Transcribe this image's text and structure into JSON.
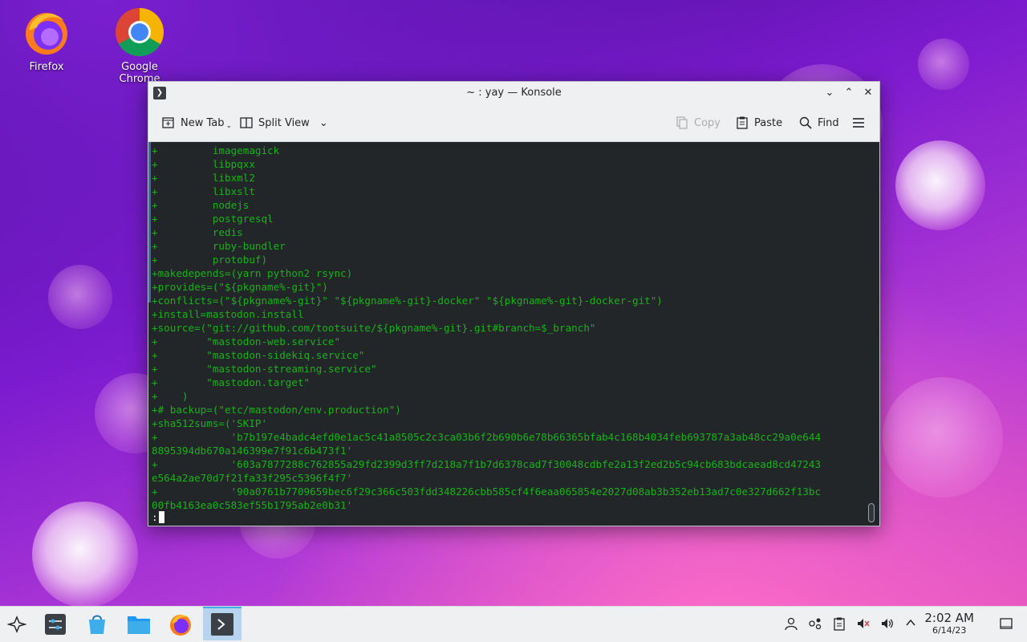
{
  "desktop": {
    "icons": [
      {
        "label": "Firefox",
        "icon": "firefox-icon"
      },
      {
        "label": "Google Chrome",
        "icon": "chrome-icon"
      }
    ]
  },
  "window": {
    "title": "~ : yay — Konsole",
    "toolbar": {
      "new_tab": "New Tab",
      "split_view": "Split View",
      "copy": "Copy",
      "paste": "Paste",
      "find": "Find"
    },
    "terminal": {
      "lines": [
        "+         imagemagick",
        "+         libpqxx",
        "+         libxml2",
        "+         libxslt",
        "+         nodejs",
        "+         postgresql",
        "+         redis",
        "+         ruby-bundler",
        "+         protobuf)",
        "+makedepends=(yarn python2 rsync)",
        "+provides=(\"${pkgname%-git}\")",
        "+conflicts=(\"${pkgname%-git}\" \"${pkgname%-git}-docker\" \"${pkgname%-git}-docker-git\")",
        "+install=mastodon.install",
        "+source=(\"git://github.com/tootsuite/${pkgname%-git}.git#branch=$_branch\"",
        "+        \"mastodon-web.service\"",
        "+        \"mastodon-sidekiq.service\"",
        "+        \"mastodon-streaming.service\"",
        "+        \"mastodon.target\"",
        "+    )",
        "+# backup=(\"etc/mastodon/env.production\")",
        "+sha512sums=('SKIP'",
        "+            'b7b197e4badc4efd0e1ac5c41a8505c2c3ca03b6f2b690b6e78b66365bfab4c168b4034feb693787a3ab48cc29a0e644",
        "8895394db670a146399e7f91c6b473f1'",
        "+            '603a7877288c762855a29fd2399d3ff7d218a7f1b7d6378cad7f30048cdbfe2a13f2ed2b5c94cb683bdcaead8cd47243",
        "e564a2ae70d7f21fa33f295c5396f4f7'",
        "+            '90a0761b7709659bec6f29c366c503fdd348226cbb585cf4f6eaa065854e2027d08ab3b352eb13ad7c0e327d662f13bc",
        "00fb4163ea0c583ef55b1795ab2e0b31'"
      ],
      "prompt": ":"
    }
  },
  "taskbar": {
    "apps": [
      "app-launcher-icon",
      "system-settings-icon",
      "discover-icon",
      "dolphin-folder-icon",
      "firefox-icon",
      "konsole-icon"
    ],
    "clock": {
      "time": "2:02 AM",
      "date": "6/14/23"
    }
  },
  "colors": {
    "terminal_bg": "#232629",
    "terminal_fg": "#18b218",
    "accent": "#3daee9"
  }
}
